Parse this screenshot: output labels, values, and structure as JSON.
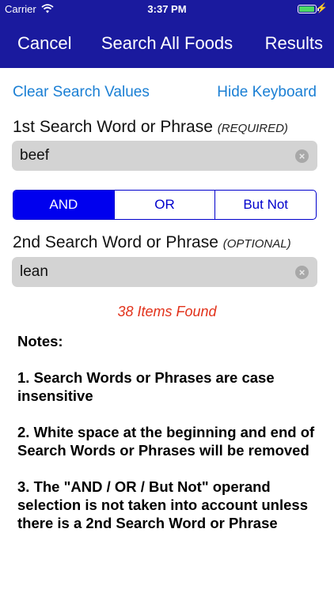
{
  "status_bar": {
    "carrier": "Carrier",
    "time": "3:37 PM",
    "battery_level": 0.95
  },
  "nav": {
    "cancel": "Cancel",
    "title": "Search All Foods",
    "results": "Results"
  },
  "actions": {
    "clear": "Clear Search Values",
    "hide_keyboard": "Hide Keyboard"
  },
  "search1": {
    "label": "1st Search Word or Phrase",
    "hint": "(REQUIRED)",
    "value": "beef"
  },
  "operand": {
    "options": [
      "AND",
      "OR",
      "But Not"
    ],
    "selected": "AND"
  },
  "search2": {
    "label": "2nd Search Word or Phrase",
    "hint": "(OPTIONAL)",
    "value": "lean"
  },
  "found": "38 Items Found",
  "notes": {
    "heading": "Notes:",
    "items": [
      "1. Search Words or Phrases are case insensitive",
      "2. White space at the beginning and end of Search Words or Phrases will be removed",
      "3. The \"AND / OR / But Not\" operand selection is not taken into account unless there is a 2nd Search Word or Phrase"
    ]
  },
  "colors": {
    "nav_bg": "#1a1a9e",
    "link": "#1a7fd4",
    "segment": "#0000ee",
    "found": "#e2321b"
  }
}
